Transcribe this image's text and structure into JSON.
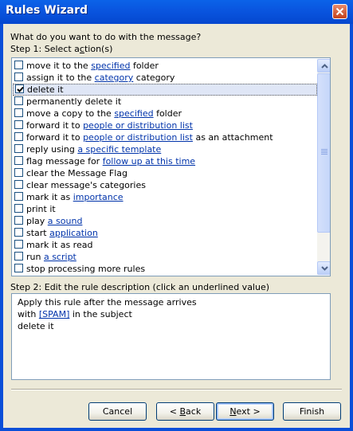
{
  "window": {
    "title": "Rules Wizard"
  },
  "question": "What do you want to do with the message?",
  "step1": {
    "prefix": "Step 1: Select a",
    "accel": "c",
    "suffix": "tion(s)"
  },
  "actions": [
    {
      "checked": false,
      "pre": "move it to the ",
      "link": "specified",
      "post": " folder"
    },
    {
      "checked": false,
      "pre": "assign it to the ",
      "link": "category",
      "post": " category"
    },
    {
      "checked": true,
      "pre": "delete it",
      "link": "",
      "post": ""
    },
    {
      "checked": false,
      "pre": "permanently delete it",
      "link": "",
      "post": ""
    },
    {
      "checked": false,
      "pre": "move a copy to the ",
      "link": "specified",
      "post": " folder"
    },
    {
      "checked": false,
      "pre": "forward it to ",
      "link": "people or distribution list",
      "post": ""
    },
    {
      "checked": false,
      "pre": "forward it to ",
      "link": "people or distribution list",
      "post": " as an attachment"
    },
    {
      "checked": false,
      "pre": "reply using ",
      "link": "a specific template",
      "post": ""
    },
    {
      "checked": false,
      "pre": "flag message for ",
      "link": "follow up at this time",
      "post": ""
    },
    {
      "checked": false,
      "pre": "clear the Message Flag",
      "link": "",
      "post": ""
    },
    {
      "checked": false,
      "pre": "clear message's categories",
      "link": "",
      "post": ""
    },
    {
      "checked": false,
      "pre": "mark it as ",
      "link": "importance",
      "post": ""
    },
    {
      "checked": false,
      "pre": "print it",
      "link": "",
      "post": ""
    },
    {
      "checked": false,
      "pre": "play ",
      "link": "a sound",
      "post": ""
    },
    {
      "checked": false,
      "pre": "start ",
      "link": "application",
      "post": ""
    },
    {
      "checked": false,
      "pre": "mark it as read",
      "link": "",
      "post": ""
    },
    {
      "checked": false,
      "pre": "run ",
      "link": "a script",
      "post": ""
    },
    {
      "checked": false,
      "pre": "stop processing more rules",
      "link": "",
      "post": ""
    }
  ],
  "step2": {
    "label": "Step 2: Edit the rule description (click an underlined value)"
  },
  "description": {
    "line1": "Apply this rule after the message arrives",
    "line2_pre": "with ",
    "line2_link": "[SPAM]",
    "line2_post": " in the subject",
    "line3": "delete it"
  },
  "buttons": {
    "cancel": "Cancel",
    "back_pre": "< ",
    "back_accel": "B",
    "back_post": "ack",
    "next_accel": "N",
    "next_post": "ext >",
    "finish": "Finish"
  }
}
